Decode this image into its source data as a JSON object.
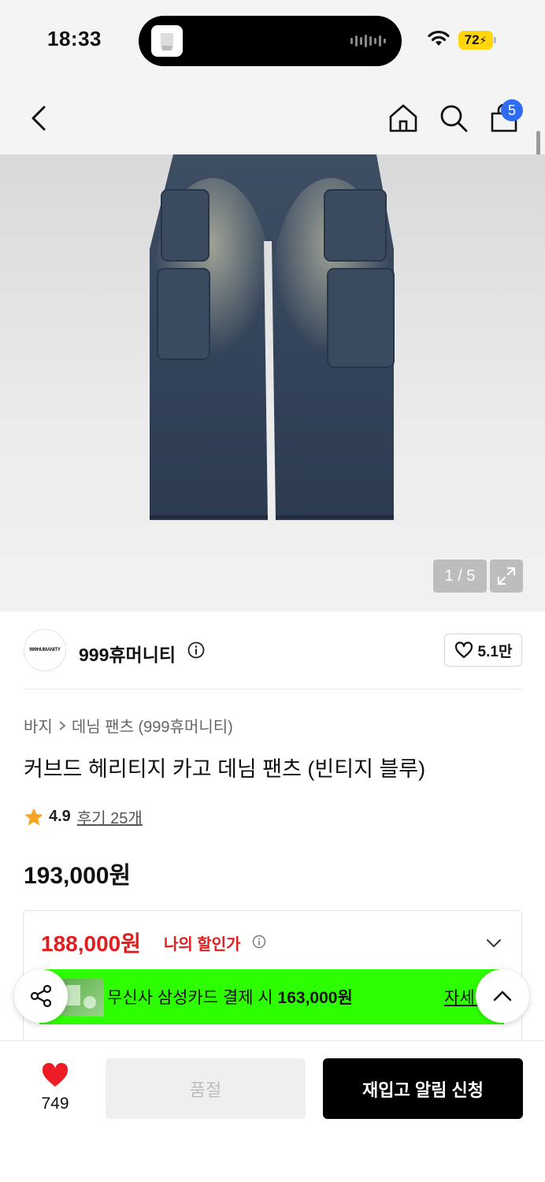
{
  "status_bar": {
    "time": "18:33",
    "battery": "72"
  },
  "nav": {
    "cart_count": "5"
  },
  "gallery": {
    "counter": "1 / 5"
  },
  "brand": {
    "logo_text": "999HUMANITY",
    "name": "999휴머니티",
    "likes": "5.1만"
  },
  "breadcrumb": {
    "category": "바지",
    "subcategory": "데님 팬츠 (999휴머니티)"
  },
  "product": {
    "title": "커브드 헤리티지 카고 데님 팬츠 (빈티지 블루)",
    "rating": "4.9",
    "reviews": "후기 25개",
    "price": "193,000원"
  },
  "benefit": {
    "my_price": "188,000원",
    "my_price_label": "나의 할인가",
    "card_text": "무신사 삼성카드 결제 시 ",
    "card_price": "163,000원",
    "card_detail": "자세히"
  },
  "bottom_bar": {
    "like_count": "749",
    "soldout_label": "품절",
    "restock_label": "재입고 알림 신청"
  },
  "colors": {
    "accent_red": "#e01e1e",
    "banner_green": "#2dff00",
    "badge_blue": "#2f6cf6"
  }
}
